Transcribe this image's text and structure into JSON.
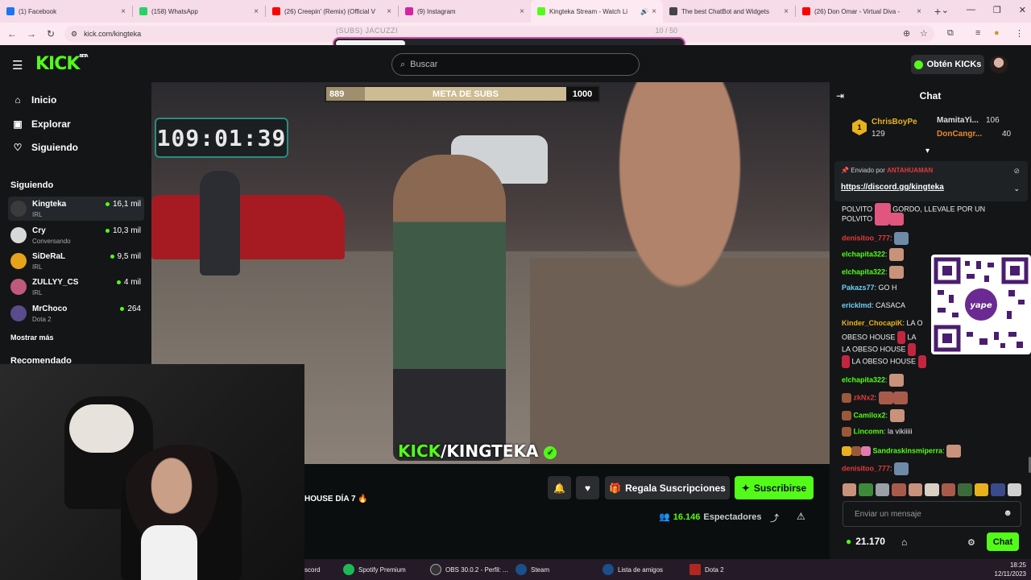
{
  "browser": {
    "tabs": [
      {
        "title": "(1) Facebook",
        "favicon_color": "#1877f2"
      },
      {
        "title": "(158) WhatsApp",
        "favicon_color": "#25d366"
      },
      {
        "title": "(26) Creepin' (Remix) (Official V",
        "favicon_color": "#ff0000"
      },
      {
        "title": "(9) Instagram",
        "favicon_color": "#d6249f"
      },
      {
        "title": "Kingteka Stream - Watch Li",
        "favicon_color": "#53fc18"
      },
      {
        "title": "The best ChatBot and Widgets",
        "favicon_color": "#444444"
      },
      {
        "title": "(26) Don Omar - Virtual Diva -",
        "favicon_color": "#ff0000"
      }
    ],
    "url": "kick.com/kingteka",
    "subs_goal_label": "(SUBS) JACUZZI",
    "subs_goal_count": "10 / 50",
    "subs_goal_progress": 0.2
  },
  "header": {
    "logo": "KICK",
    "logo_sup": "BETA",
    "search_placeholder": "Buscar",
    "get_kicks_label": "Obtén KICKs"
  },
  "sidebar": {
    "nav": [
      {
        "label": "Inicio",
        "icon": "home-icon"
      },
      {
        "label": "Explorar",
        "icon": "compass-icon"
      },
      {
        "label": "Siguiendo",
        "icon": "heart-icon"
      }
    ],
    "following_title": "Siguiendo",
    "channels": [
      {
        "name": "Kingteka",
        "category": "IRL",
        "viewers": "16,1 mil",
        "avatar_color": "#3b3b3b"
      },
      {
        "name": "Cry",
        "category": "Conversando",
        "viewers": "10,3 mil",
        "avatar_color": "#d8d8d8"
      },
      {
        "name": "SiDeRaL",
        "category": "IRL",
        "viewers": "9,5 mil",
        "avatar_color": "#e6a21a"
      },
      {
        "name": "ZULLYY_CS",
        "category": "IRL",
        "viewers": "4 mil",
        "avatar_color": "#c05a7a"
      },
      {
        "name": "MrChoco",
        "category": "Dota 2",
        "viewers": "264",
        "avatar_color": "#5a4b8c"
      }
    ],
    "show_more": "Mostrar más",
    "recommended_title": "Recomendado"
  },
  "video": {
    "goal_current": "889",
    "goal_label": "META DE SUBS",
    "goal_target": "1000",
    "goal_progress": 0.889,
    "timer": "109:01:39",
    "watermark_kick": "KICK",
    "watermark_channel": "/KINGTEKA"
  },
  "stream": {
    "title": "HOUSE DÍA 7 🔥",
    "gift_subs_label": "Regala Suscripciones",
    "subscribe_label": "Suscribirse",
    "viewers_count": "16.146",
    "viewers_label": "Espectadores"
  },
  "chat": {
    "title": "Chat",
    "leaders": [
      {
        "rank": "1",
        "name": "ChrisBoyPe",
        "count": "129"
      },
      {
        "name": "MamitaYi...",
        "count": "106"
      },
      {
        "name": "DonCangr...",
        "count": "40"
      }
    ],
    "pinned": {
      "by_label": "Enviado por",
      "by_user": "ANTAHUAMAN",
      "link": "https://discord.gg/kingteka"
    },
    "messages": [
      {
        "user": "",
        "text": "POLVITO",
        "color": "#eeeeee"
      },
      {
        "user": "",
        "text": "GORDO, LLEVALE POR UN",
        "color": "#eeeeee"
      },
      {
        "user": "",
        "text": "POLVITO",
        "color": "#eeeeee"
      },
      {
        "user": "denisitoo_777",
        "text": ":",
        "color": "#e23a3a"
      },
      {
        "user": "elchapita322",
        "text": ":",
        "color": "#53fc18"
      },
      {
        "user": "elchapita322",
        "text": ":",
        "color": "#53fc18"
      },
      {
        "user": "Pakazs77",
        "text": ": GO H",
        "color": "#6dd0f5"
      },
      {
        "user": "erickImd",
        "text": ": CASACA",
        "color": "#6dd0f5"
      },
      {
        "user": "Kinder_ChocapiK",
        "text": ": LA O",
        "color": "#e8b21d"
      },
      {
        "user": "",
        "text": "OBESO HOUSE",
        "color": "#eeeeee"
      },
      {
        "user": "",
        "text": "LA",
        "color": "#eeeeee"
      },
      {
        "user": "",
        "text": "LA OBESO HOUSE",
        "color": "#eeeeee"
      },
      {
        "user": "",
        "text": "LA OBESO HOUSE",
        "color": "#eeeeee"
      },
      {
        "user": "elchapita322",
        "text": ":",
        "color": "#53fc18"
      },
      {
        "user": "zkNx2",
        "text": ":",
        "color": "#e23a3a"
      },
      {
        "user": "Camilox2",
        "text": ":",
        "color": "#53fc18"
      },
      {
        "user": "Lincomn",
        "text": ": la vikiiiii",
        "color": "#53fc18"
      },
      {
        "user": "Sandraskinsmiperra",
        "text": ":",
        "color": "#53fc18"
      },
      {
        "user": "denisitoo_777",
        "text": ":",
        "color": "#e23a3a"
      }
    ],
    "input_placeholder": "Enviar un mensaje",
    "kicks_balance": "21.170",
    "send_label": "Chat"
  },
  "taskbar": {
    "items": [
      "scord",
      "Spotify Premium",
      "OBS 30.0.2 - Perfil: ...",
      "Steam",
      "Lista de amigos",
      "Dota 2"
    ],
    "time": "18:25",
    "date": "12/11/2023"
  },
  "colors": {
    "kick_green": "#53fc18",
    "background": "#0b0e0f",
    "panel": "#141517"
  }
}
